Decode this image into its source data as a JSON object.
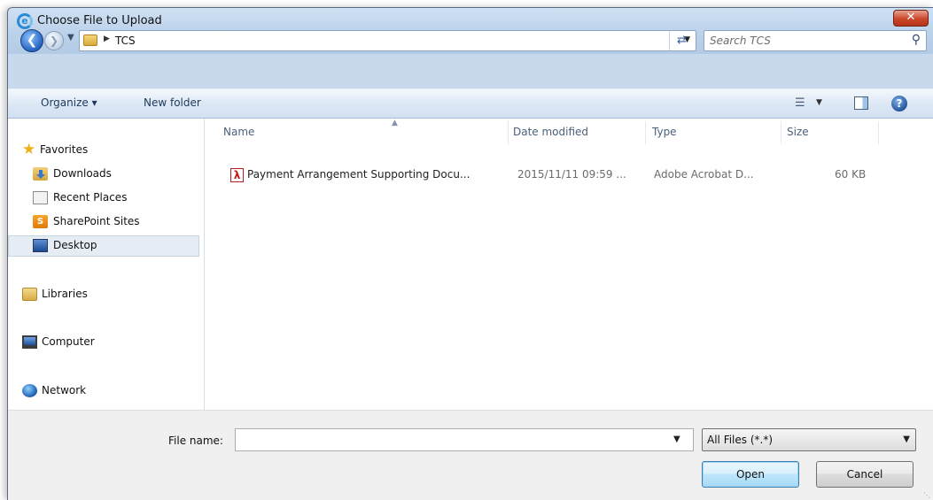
{
  "window": {
    "title": "Choose File to Upload",
    "close_symbol": "✕",
    "accent_color": "#c9462a"
  },
  "address_bar": {
    "path": "TCS",
    "search_placeholder": "Search TCS"
  },
  "command_bar": {
    "organize_label": "Organize ▾",
    "new_folder_label": "New folder",
    "help_symbol": "?"
  },
  "nav_pane": {
    "favorites": "Favorites",
    "downloads": "Downloads",
    "recent_places": "Recent Places",
    "sharepoint_sites": "SharePoint Sites",
    "desktop": "Desktop",
    "libraries": "Libraries",
    "computer": "Computer",
    "network": "Network",
    "selected_item": "Desktop"
  },
  "file_list": {
    "columns": [
      "Name",
      "Date modified",
      "Type",
      "Size"
    ],
    "rows": [
      {
        "name": "Payment Arrangement Supporting Docu...",
        "date_modified": "2015/11/11 09:59 ...",
        "type": "Adobe Acrobat D...",
        "size": "60 KB",
        "icon": "pdf-icon"
      }
    ]
  },
  "footer": {
    "file_name_label": "File name:",
    "file_name_value": "",
    "file_type_value": "All Files (*.*)",
    "open_label": "Open",
    "cancel_label": "Cancel"
  }
}
